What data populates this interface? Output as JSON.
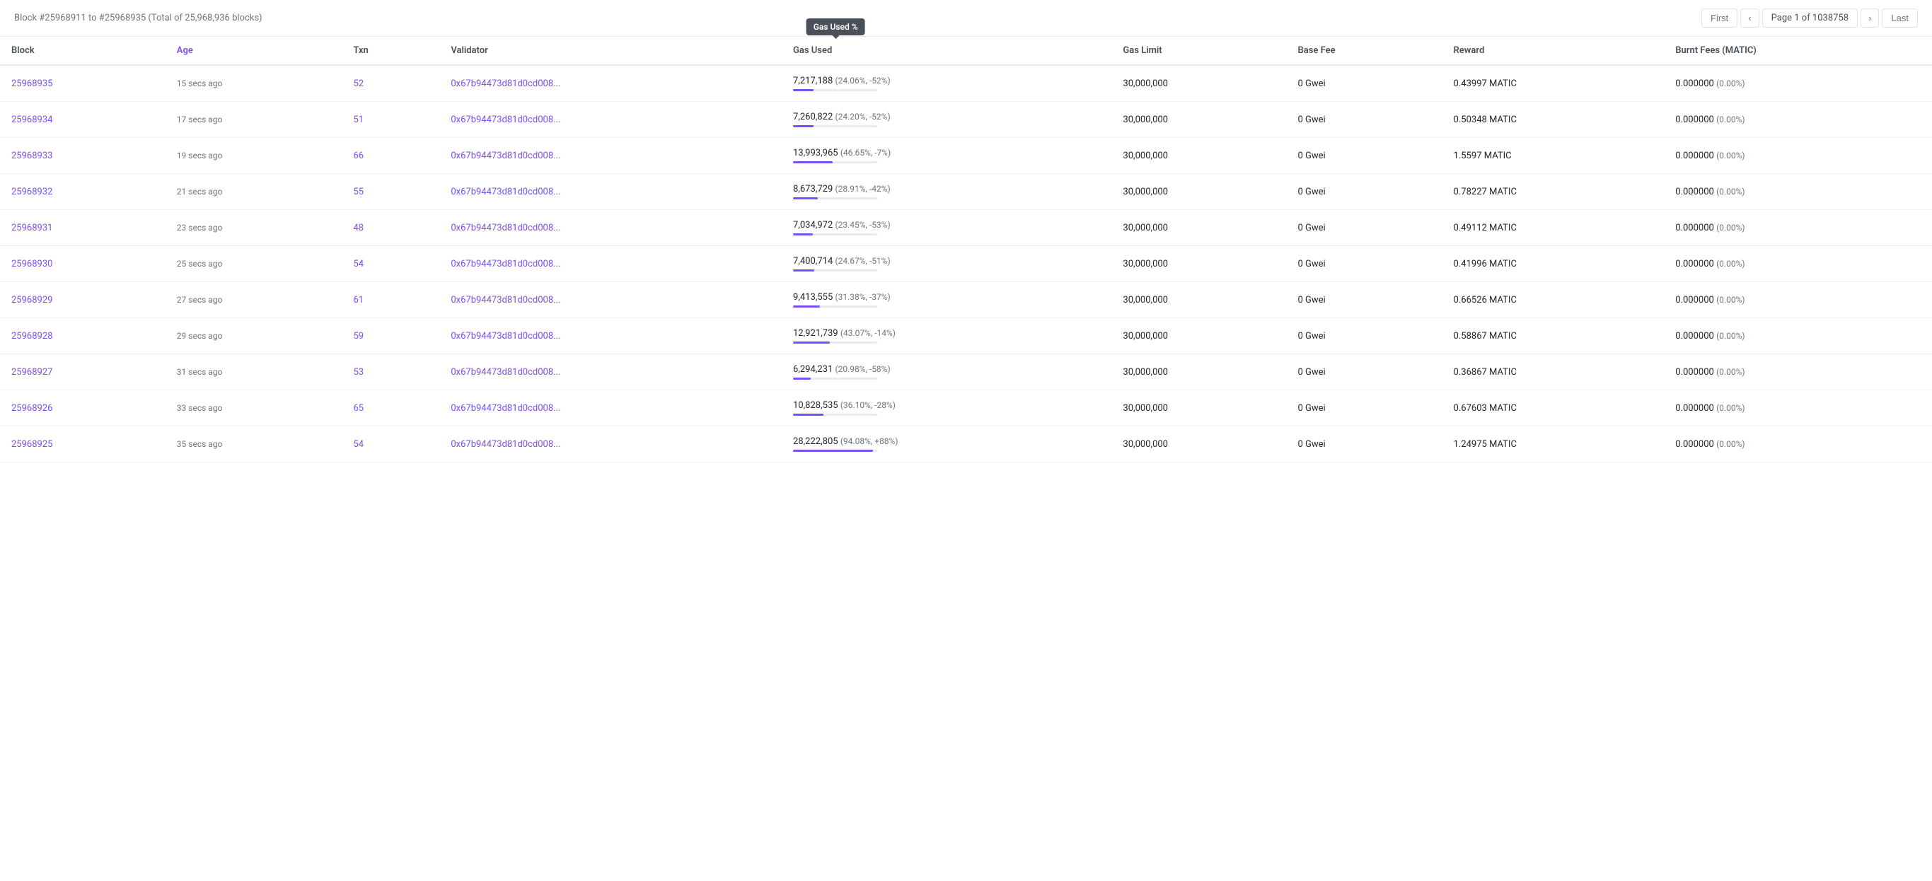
{
  "header": {
    "block_range": "Block #25968911 to #25968935 (Total of 25,968,936 blocks)",
    "pagination": {
      "first_label": "First",
      "last_label": "Last",
      "prev_label": "‹",
      "next_label": "›",
      "page_text": "Page 1 of 1038758"
    }
  },
  "columns": {
    "block": "Block",
    "age": "Age",
    "txn": "Txn",
    "validator": "Validator",
    "gas_used": "Gas Used",
    "gas_used_pct": "Gas Used %",
    "gas_limit": "Gas Limit",
    "base_fee": "Base Fee",
    "reward": "Reward",
    "burnt_fees": "Burnt Fees (MATIC)"
  },
  "tooltip": {
    "gas_used_pct": "Gas Used %"
  },
  "rows": [
    {
      "block": "25968935",
      "age": "15 secs ago",
      "txn": "52",
      "validator": "0x67b94473d81d0cd008...",
      "gas_used": "7,217,188",
      "gas_used_extra": "(24.06%, -52%)",
      "gas_pct": 24.06,
      "gas_limit": "30,000,000",
      "base_fee": "0 Gwei",
      "reward": "0.43997 MATIC",
      "burnt_fees": "0.000000",
      "burnt_fees_extra": "(0.00%)"
    },
    {
      "block": "25968934",
      "age": "17 secs ago",
      "txn": "51",
      "validator": "0x67b94473d81d0cd008...",
      "gas_used": "7,260,822",
      "gas_used_extra": "(24.20%, -52%)",
      "gas_pct": 24.2,
      "gas_limit": "30,000,000",
      "base_fee": "0 Gwei",
      "reward": "0.50348 MATIC",
      "burnt_fees": "0.000000",
      "burnt_fees_extra": "(0.00%)"
    },
    {
      "block": "25968933",
      "age": "19 secs ago",
      "txn": "66",
      "validator": "0x67b94473d81d0cd008...",
      "gas_used": "13,993,965",
      "gas_used_extra": "(46.65%, -7%)",
      "gas_pct": 46.65,
      "gas_limit": "30,000,000",
      "base_fee": "0 Gwei",
      "reward": "1.5597 MATIC",
      "burnt_fees": "0.000000",
      "burnt_fees_extra": "(0.00%)"
    },
    {
      "block": "25968932",
      "age": "21 secs ago",
      "txn": "55",
      "validator": "0x67b94473d81d0cd008...",
      "gas_used": "8,673,729",
      "gas_used_extra": "(28.91%, -42%)",
      "gas_pct": 28.91,
      "gas_limit": "30,000,000",
      "base_fee": "0 Gwei",
      "reward": "0.78227 MATIC",
      "burnt_fees": "0.000000",
      "burnt_fees_extra": "(0.00%)"
    },
    {
      "block": "25968931",
      "age": "23 secs ago",
      "txn": "48",
      "validator": "0x67b94473d81d0cd008...",
      "gas_used": "7,034,972",
      "gas_used_extra": "(23.45%, -53%)",
      "gas_pct": 23.45,
      "gas_limit": "30,000,000",
      "base_fee": "0 Gwei",
      "reward": "0.49112 MATIC",
      "burnt_fees": "0.000000",
      "burnt_fees_extra": "(0.00%)"
    },
    {
      "block": "25968930",
      "age": "25 secs ago",
      "txn": "54",
      "validator": "0x67b94473d81d0cd008...",
      "gas_used": "7,400,714",
      "gas_used_extra": "(24.67%, -51%)",
      "gas_pct": 24.67,
      "gas_limit": "30,000,000",
      "base_fee": "0 Gwei",
      "reward": "0.41996 MATIC",
      "burnt_fees": "0.000000",
      "burnt_fees_extra": "(0.00%)"
    },
    {
      "block": "25968929",
      "age": "27 secs ago",
      "txn": "61",
      "validator": "0x67b94473d81d0cd008...",
      "gas_used": "9,413,555",
      "gas_used_extra": "(31.38%, -37%)",
      "gas_pct": 31.38,
      "gas_limit": "30,000,000",
      "base_fee": "0 Gwei",
      "reward": "0.66526 MATIC",
      "burnt_fees": "0.000000",
      "burnt_fees_extra": "(0.00%)"
    },
    {
      "block": "25968928",
      "age": "29 secs ago",
      "txn": "59",
      "validator": "0x67b94473d81d0cd008...",
      "gas_used": "12,921,739",
      "gas_used_extra": "(43.07%, -14%)",
      "gas_pct": 43.07,
      "gas_limit": "30,000,000",
      "base_fee": "0 Gwei",
      "reward": "0.58867 MATIC",
      "burnt_fees": "0.000000",
      "burnt_fees_extra": "(0.00%)"
    },
    {
      "block": "25968927",
      "age": "31 secs ago",
      "txn": "53",
      "validator": "0x67b94473d81d0cd008...",
      "gas_used": "6,294,231",
      "gas_used_extra": "(20.98%, -58%)",
      "gas_pct": 20.98,
      "gas_limit": "30,000,000",
      "base_fee": "0 Gwei",
      "reward": "0.36867 MATIC",
      "burnt_fees": "0.000000",
      "burnt_fees_extra": "(0.00%)"
    },
    {
      "block": "25968926",
      "age": "33 secs ago",
      "txn": "65",
      "validator": "0x67b94473d81d0cd008...",
      "gas_used": "10,828,535",
      "gas_used_extra": "(36.10%, -28%)",
      "gas_pct": 36.1,
      "gas_limit": "30,000,000",
      "base_fee": "0 Gwei",
      "reward": "0.67603 MATIC",
      "burnt_fees": "0.000000",
      "burnt_fees_extra": "(0.00%)"
    },
    {
      "block": "25968925",
      "age": "35 secs ago",
      "txn": "54",
      "validator": "0x67b94473d81d0cd008...",
      "gas_used": "28,222,805",
      "gas_used_extra": "(94.08%, +88%)",
      "gas_pct": 94.08,
      "gas_limit": "30,000,000",
      "base_fee": "0 Gwei",
      "reward": "1.24975 MATIC",
      "burnt_fees": "0.000000",
      "burnt_fees_extra": "(0.00%)"
    }
  ],
  "colors": {
    "accent": "#7950f2",
    "muted": "#6c757d",
    "border": "#e9ecef",
    "bar_bg": "#e9ecef"
  }
}
